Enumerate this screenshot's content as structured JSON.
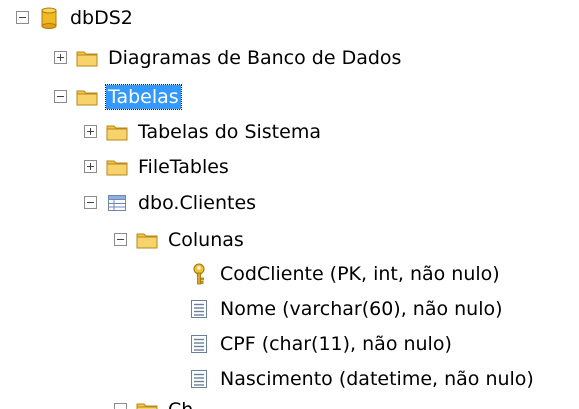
{
  "tree": {
    "database": {
      "label": "dbDS2",
      "icon": "database-icon",
      "expanded": true
    },
    "diagrams": {
      "label": "Diagramas de Banco de Dados",
      "icon": "folder-icon",
      "expanded": false
    },
    "tables": {
      "label": "Tabelas",
      "icon": "folder-icon",
      "expanded": true,
      "selected": true
    },
    "system_tables": {
      "label": "Tabelas do Sistema",
      "icon": "folder-icon",
      "expanded": false
    },
    "file_tables": {
      "label": "FileTables",
      "icon": "folder-icon",
      "expanded": false
    },
    "clientes": {
      "label": "dbo.Clientes",
      "icon": "table-icon",
      "expanded": true
    },
    "columns_folder": {
      "label": "Colunas",
      "icon": "folder-icon",
      "expanded": true
    },
    "columns": [
      {
        "label": "CodCliente (PK, int, não nulo)",
        "icon": "primary-key-icon"
      },
      {
        "label": "Nome (varchar(60), não nulo)",
        "icon": "column-icon"
      },
      {
        "label": "CPF (char(11), não nulo)",
        "icon": "column-icon"
      },
      {
        "label": "Nascimento (datetime, não nulo)",
        "icon": "column-icon"
      }
    ],
    "keys_folder_partial": {
      "label": "Ch",
      "icon": "folder-icon"
    }
  },
  "colors": {
    "selection": "#3399ff",
    "folder": "#f5c242",
    "database": "#e9b22a",
    "key": "#d9a21b",
    "expander_border": "#8c8c8c"
  }
}
